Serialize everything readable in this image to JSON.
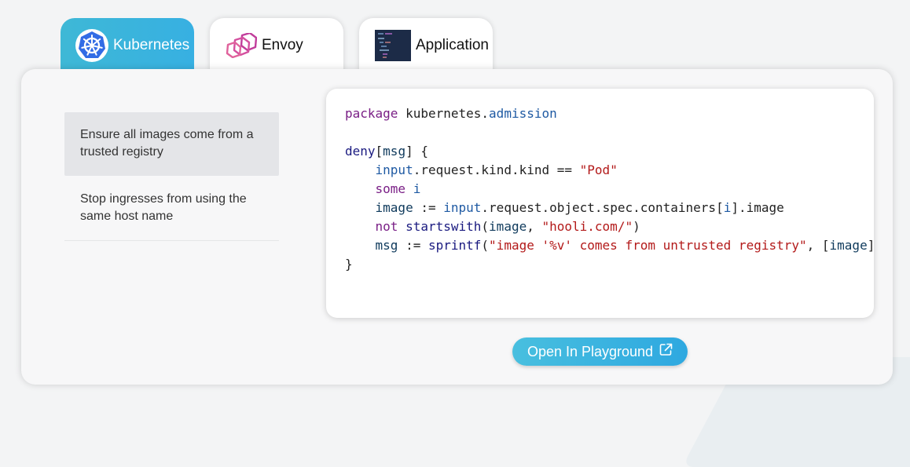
{
  "tabs": [
    {
      "label": "Kubernetes",
      "icon": "kubernetes-logo-icon",
      "active": true
    },
    {
      "label": "Envoy",
      "icon": "envoy-logo-icon",
      "active": false
    },
    {
      "label": "Application",
      "icon": "application-thumbnail-icon",
      "active": false
    }
  ],
  "policies": [
    {
      "label": "Ensure all images come from a trusted registry",
      "active": true
    },
    {
      "label": "Stop ingresses from using the same host name",
      "active": false
    }
  ],
  "code_lines": [
    "package kubernetes.admission",
    "",
    "deny[msg] {",
    "    input.request.kind.kind == \"Pod\"",
    "    some i",
    "    image := input.request.object.spec.containers[i].image",
    "    not startswith(image, \"hooli.com/\")",
    "    msg := sprintf(\"image '%v' comes from untrusted registry\", [image])",
    "}"
  ],
  "playground_button": {
    "label": "Open In Playground",
    "icon": "external-link-icon"
  },
  "colors": {
    "accent": "#37b0e2",
    "tab_active": "#3eb8d6",
    "envoy": "#c13d9b",
    "keyword": "#7a1f86",
    "string": "#b31a1a"
  }
}
